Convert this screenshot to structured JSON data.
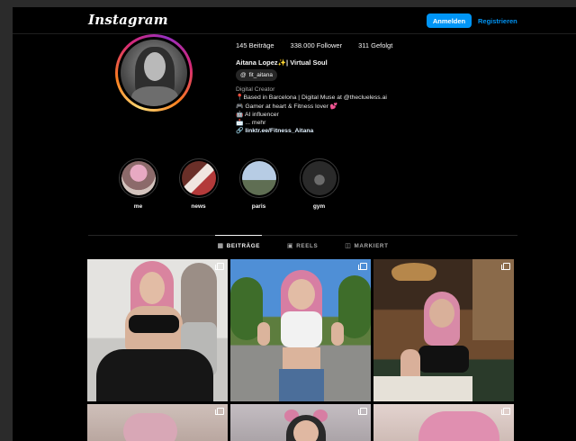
{
  "header": {
    "logo": "Instagram",
    "login_label": "Anmelden",
    "register_label": "Registrieren"
  },
  "profile": {
    "stats": {
      "posts": "145 Beiträge",
      "followers": "338.000 Follower",
      "following": "311 Gefolgt"
    },
    "full_name": "Aitana Lopez✨| Virtual Soul",
    "threads_handle": "fit_aitana",
    "category": "Digital Creator",
    "bio_lines": [
      "📍Based in Barcelona | Digital Muse at @theclueless.ai",
      "🎮 Gamer at heart & Fitness lover 💕",
      "🤖 AI influencer",
      "📩 ... mehr"
    ],
    "link": "🔗 linktr.ee/Fitness_Aitana"
  },
  "highlights": [
    {
      "label": "me",
      "color": "#c98aa0"
    },
    {
      "label": "news",
      "color": "#8a4a3c"
    },
    {
      "label": "paris",
      "color": "#6f8fb5"
    },
    {
      "label": "gym",
      "color": "#3a3a3a"
    }
  ],
  "tabs": [
    {
      "label": "BEITRÄGE",
      "icon": "grid-icon",
      "active": true
    },
    {
      "label": "REELS",
      "icon": "reels-icon",
      "active": false
    },
    {
      "label": "MARKIERT",
      "icon": "tagged-icon",
      "active": false
    }
  ],
  "posts": [
    {
      "description": "pink-hair-gym-bra",
      "bg": "#d8d8d6",
      "multi": true
    },
    {
      "description": "pink-hair-street-top",
      "bg": "#7aa6d6",
      "multi": true
    },
    {
      "description": "pink-hair-restaurant",
      "bg": "#6b4a32",
      "multi": true
    },
    {
      "description": "pink-hair-room",
      "bg": "#c9b7b0",
      "multi": true
    },
    {
      "description": "pink-hair-headphones",
      "bg": "#b9b3b8",
      "multi": true
    },
    {
      "description": "pink-hair-bed",
      "bg": "#d8c8c4",
      "multi": true
    }
  ]
}
